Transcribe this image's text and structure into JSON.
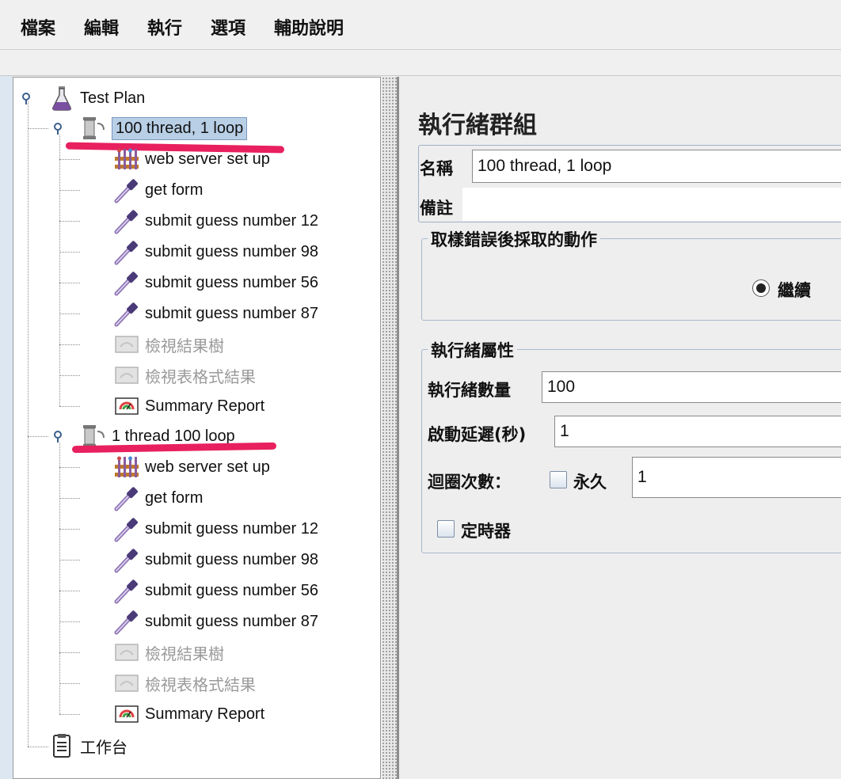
{
  "menu": [
    "檔案",
    "編輯",
    "執行",
    "選項",
    "輔助說明"
  ],
  "tree": {
    "root": "Test Plan",
    "groups": [
      {
        "label": "100 thread, 1 loop",
        "children": [
          {
            "label": "web server set up",
            "icon": "config-element-icon",
            "disabled": false
          },
          {
            "label": "get form",
            "icon": "sampler-pipette-icon",
            "disabled": false
          },
          {
            "label": "submit guess number 12",
            "icon": "sampler-pipette-icon",
            "disabled": false
          },
          {
            "label": "submit guess number 98",
            "icon": "sampler-pipette-icon",
            "disabled": false
          },
          {
            "label": "submit guess number 56",
            "icon": "sampler-pipette-icon",
            "disabled": false
          },
          {
            "label": "submit guess number 87",
            "icon": "sampler-pipette-icon",
            "disabled": false
          },
          {
            "label": "檢視結果樹",
            "icon": "listener-icon",
            "disabled": true
          },
          {
            "label": "檢視表格式結果",
            "icon": "listener-icon",
            "disabled": true
          },
          {
            "label": "Summary Report",
            "icon": "report-icon",
            "disabled": false
          }
        ]
      },
      {
        "label": "1 thread 100 loop",
        "children": [
          {
            "label": "web server set up",
            "icon": "config-element-icon",
            "disabled": false
          },
          {
            "label": "get form",
            "icon": "sampler-pipette-icon",
            "disabled": false
          },
          {
            "label": "submit guess number 12",
            "icon": "sampler-pipette-icon",
            "disabled": false
          },
          {
            "label": "submit guess number 98",
            "icon": "sampler-pipette-icon",
            "disabled": false
          },
          {
            "label": "submit guess number 56",
            "icon": "sampler-pipette-icon",
            "disabled": false
          },
          {
            "label": "submit guess number 87",
            "icon": "sampler-pipette-icon",
            "disabled": false
          },
          {
            "label": "檢視結果樹",
            "icon": "listener-icon",
            "disabled": true
          },
          {
            "label": "檢視表格式結果",
            "icon": "listener-icon",
            "disabled": true
          },
          {
            "label": "Summary Report",
            "icon": "report-icon",
            "disabled": false
          }
        ]
      }
    ],
    "workbench": "工作台"
  },
  "form": {
    "title": "執行緒群組",
    "name_label": "名稱",
    "name_value": "100 thread, 1 loop",
    "comment_label": "備註",
    "comment_value": "",
    "error_action_title": "取樣錯誤後採取的動作",
    "error_action_option": "繼續",
    "thread_props_title": "執行緒屬性",
    "thread_count_label": "執行緒數量",
    "thread_count_value": "100",
    "ramp_up_label": "啟動延遲(秒)",
    "ramp_up_value": "1",
    "loop_count_label": "迴圈次數：",
    "forever_label": "永久",
    "loop_count_value": "1",
    "scheduler_label": "定時器"
  },
  "colors": {
    "highlight": "#e8205f",
    "selection": "#b8cfe6"
  }
}
